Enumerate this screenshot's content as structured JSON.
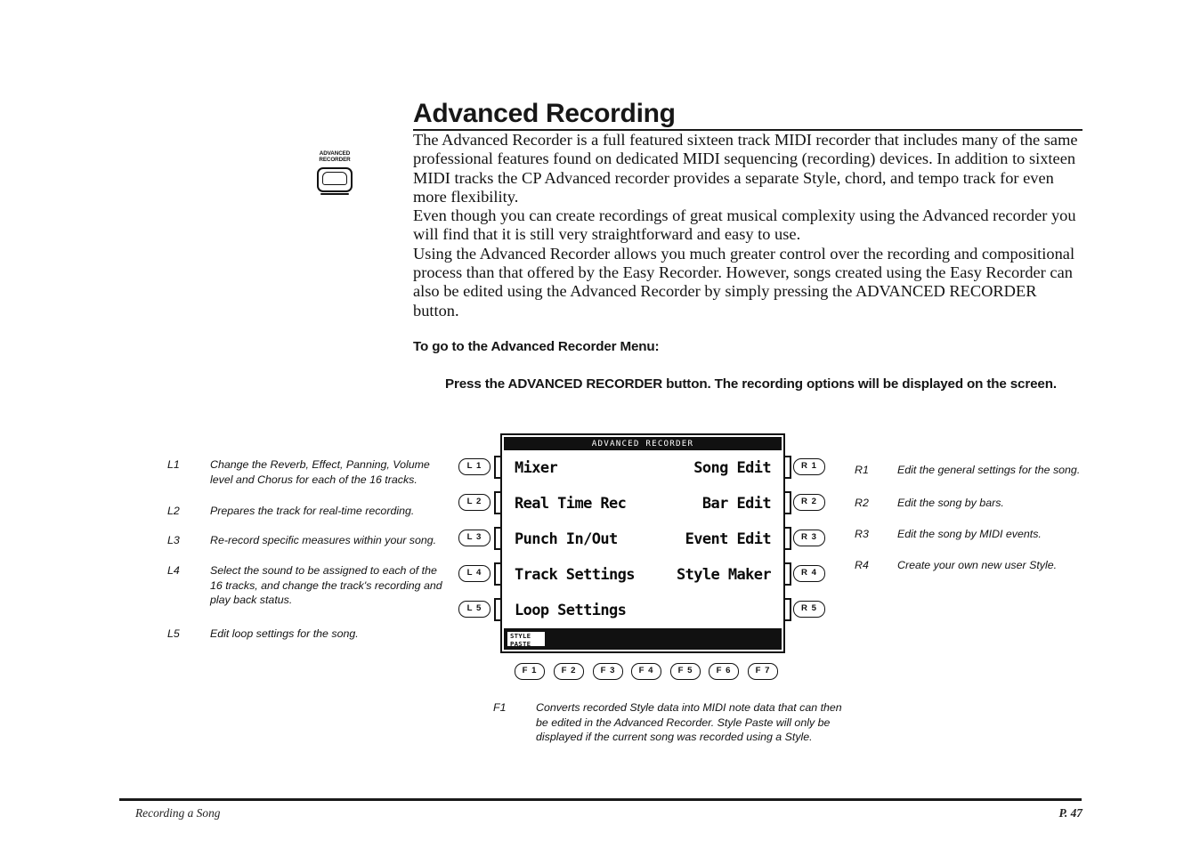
{
  "page": {
    "title": "Advanced Recording",
    "paragraphs": [
      "The Advanced Recorder is a full featured sixteen track MIDI recorder that includes many of the same professional features found on dedicated MIDI sequencing (recording) devices.  In addition to sixteen MIDI tracks the CP Advanced recorder provides a separate Style, chord, and tempo track for even more flexibility.",
      "Even though you can create recordings of great musical complexity using the Advanced recorder you will  find that it is still very straightforward and easy to use.",
      "Using the Advanced Recorder allows you much greater control over the recording and compositional process than that offered by the Easy Recorder.  However, songs created using the Easy Recorder can also be edited  using the Advanced Recorder by simply pressing the ADVANCED RECORDER button."
    ],
    "subhead_menu": "To go to the Advanced Recorder Menu:",
    "subhead_press": "Press the ADVANCED RECORDER button.  The recording options will be displayed on the screen."
  },
  "panel_button": {
    "label_line1": "ADVANCED",
    "label_line2": "RECORDER"
  },
  "lcd": {
    "title": "ADVANCED RECORDER",
    "rows": [
      {
        "left": "Mixer",
        "right": "Song Edit"
      },
      {
        "left": "Real Time Rec",
        "right": "Bar Edit"
      },
      {
        "left": "Punch In/Out",
        "right": "Event Edit"
      },
      {
        "left": "Track Settings",
        "right": "Style Maker"
      },
      {
        "left": "Loop Settings",
        "right": ""
      }
    ],
    "style_paste_line1": "STYLE",
    "style_paste_line2": "PASTE"
  },
  "soft_keys": {
    "left": [
      "L 1",
      "L 2",
      "L 3",
      "L 4",
      "L 5"
    ],
    "right": [
      "R 1",
      "R 2",
      "R 3",
      "R 4",
      "R 5"
    ],
    "function": [
      "F 1",
      "F 2",
      "F 3",
      "F 4",
      "F 5",
      "F 6",
      "F 7"
    ]
  },
  "annotations": {
    "left": [
      {
        "key": "L1",
        "text": "Change the Reverb, Effect, Panning, Volume level and Chorus for each of the 16 tracks."
      },
      {
        "key": "L2",
        "text": "Prepares the track for real-time recording."
      },
      {
        "key": "L3",
        "text": "Re-record specific measures within your song."
      },
      {
        "key": "L4",
        "text": "Select the sound to be assigned to each of the 16 tracks, and change the track's recording and play back status."
      },
      {
        "key": "L5",
        "text": "Edit loop settings for the song."
      }
    ],
    "right": [
      {
        "key": "R1",
        "text": "Edit  the general settings for the song."
      },
      {
        "key": "R2",
        "text": "Edit the song by bars."
      },
      {
        "key": "R3",
        "text": "Edit the song by MIDI events."
      },
      {
        "key": "R4",
        "text": "Create your own new user Style."
      }
    ],
    "function": [
      {
        "key": "F1",
        "text": "Converts recorded Style data into MIDI note data that can then be edited in the Advanced Recorder.  Style Paste will only be displayed if the current song was recorded using a Style."
      }
    ]
  },
  "footer": {
    "left": "Recording a Song",
    "right": "P. 47"
  }
}
